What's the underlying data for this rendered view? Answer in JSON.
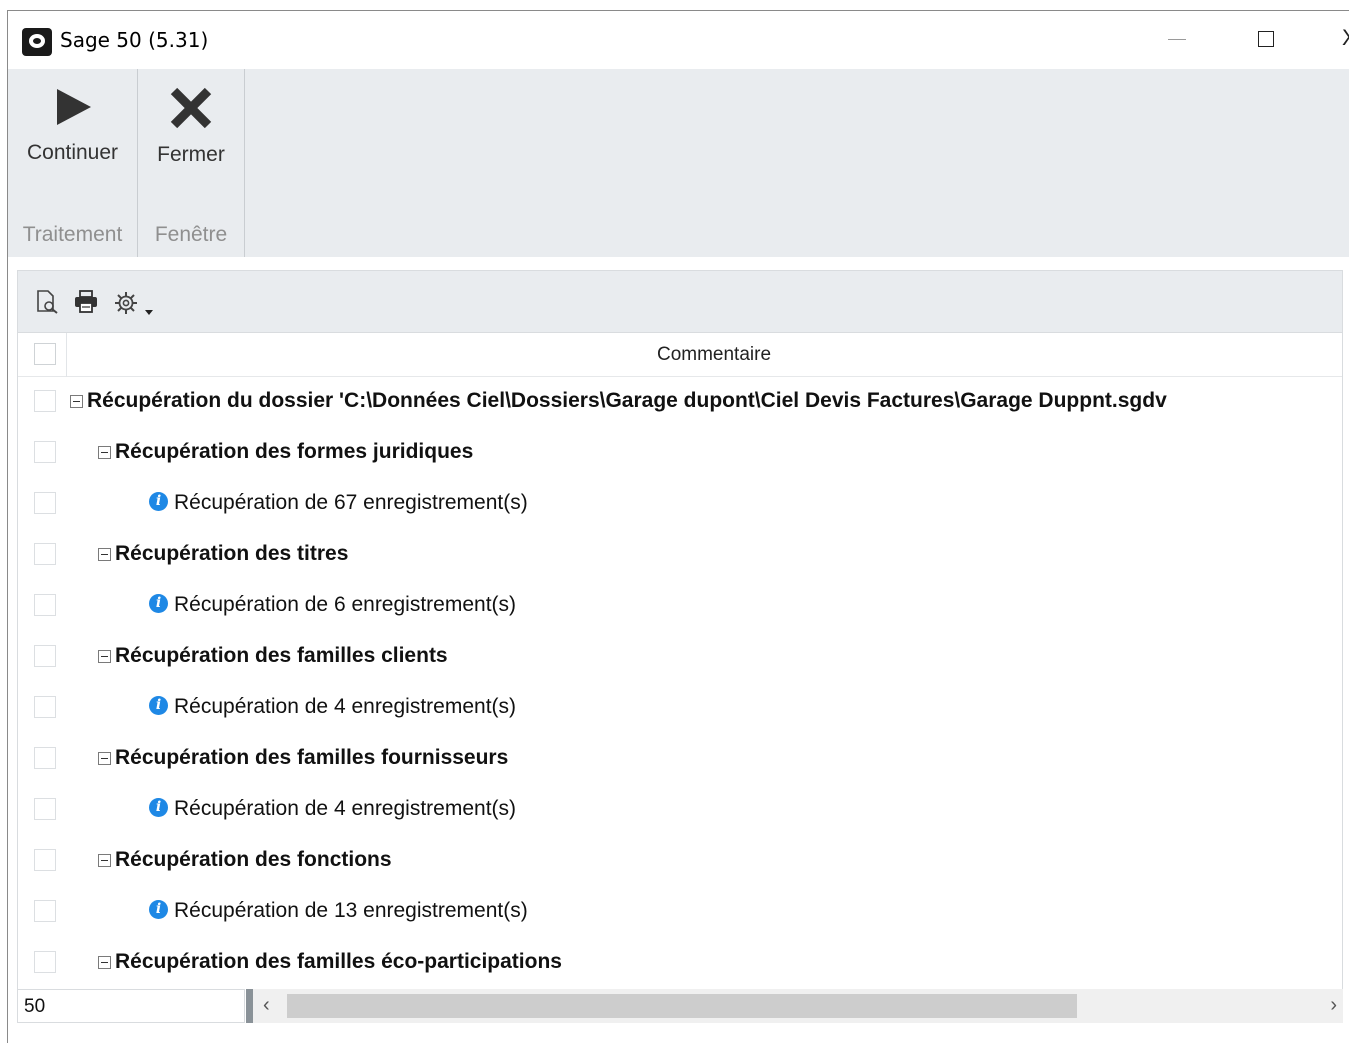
{
  "window": {
    "title": "Sage 50 (5.31)",
    "close_glyph": "X"
  },
  "ribbon": {
    "groups": [
      {
        "label": "Traitement",
        "button": {
          "label": "Continuer",
          "icon": "play-icon"
        }
      },
      {
        "label": "Fenêtre",
        "button": {
          "label": "Fermer",
          "icon": "close-x-icon"
        }
      }
    ]
  },
  "grid": {
    "toolbar": {
      "icons": [
        "preview-icon",
        "print-icon",
        "settings-gear-icon",
        "dropdown-arrow-icon"
      ]
    },
    "column_header": "Commentaire",
    "rows": [
      {
        "level": 0,
        "bold": true,
        "toggle": true,
        "info": false,
        "text": "Récupération du dossier 'C:\\Données Ciel\\Dossiers\\Garage dupont\\Ciel Devis Factures\\Garage Duppnt.sgdv"
      },
      {
        "level": 1,
        "bold": true,
        "toggle": true,
        "info": false,
        "text": "Récupération des formes juridiques"
      },
      {
        "level": 2,
        "bold": false,
        "toggle": false,
        "info": true,
        "text": "Récupération de 67 enregistrement(s)"
      },
      {
        "level": 1,
        "bold": true,
        "toggle": true,
        "info": false,
        "text": "Récupération des titres"
      },
      {
        "level": 2,
        "bold": false,
        "toggle": false,
        "info": true,
        "text": "Récupération de 6 enregistrement(s)"
      },
      {
        "level": 1,
        "bold": true,
        "toggle": true,
        "info": false,
        "text": "Récupération des familles clients"
      },
      {
        "level": 2,
        "bold": false,
        "toggle": false,
        "info": true,
        "text": "Récupération de 4 enregistrement(s)"
      },
      {
        "level": 1,
        "bold": true,
        "toggle": true,
        "info": false,
        "text": "Récupération des familles fournisseurs"
      },
      {
        "level": 2,
        "bold": false,
        "toggle": false,
        "info": true,
        "text": "Récupération de 4 enregistrement(s)"
      },
      {
        "level": 1,
        "bold": true,
        "toggle": true,
        "info": false,
        "text": "Récupération des fonctions"
      },
      {
        "level": 2,
        "bold": false,
        "toggle": false,
        "info": true,
        "text": "Récupération de 13 enregistrement(s)"
      },
      {
        "level": 1,
        "bold": true,
        "toggle": true,
        "info": false,
        "text": "Récupération des familles éco-participations"
      }
    ],
    "footer": {
      "count": "50"
    }
  },
  "colors": {
    "ribbon_bg": "#e9ecef",
    "info_blue": "#1e88e5",
    "group_label": "#8f8f8f"
  }
}
